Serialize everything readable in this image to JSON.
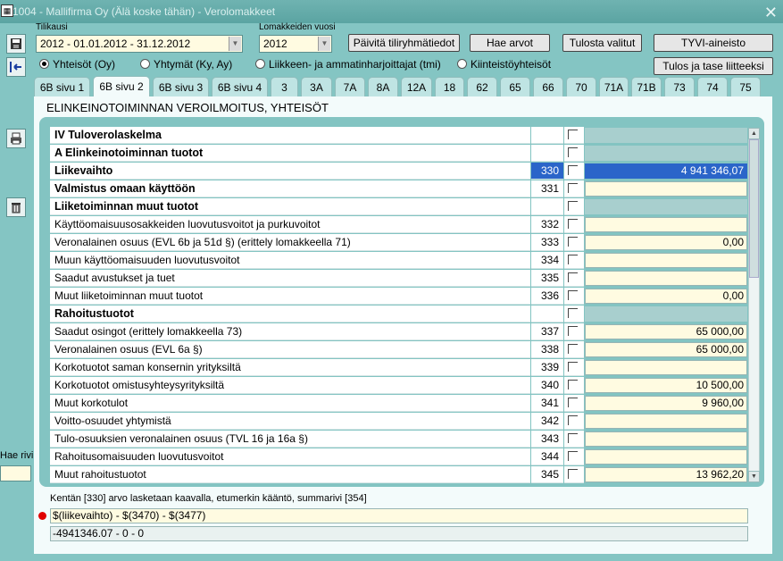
{
  "window": {
    "title": "1004 - Mallifirma Oy (Älä koske tähän) - Verolomakkeet",
    "close": "✕"
  },
  "form": {
    "tilikausi_label": "Tilikausi",
    "tilikausi_value": "2012 - 01.01.2012 - 31.12.2012",
    "vuosi_label": "Lomakkeiden vuosi",
    "vuosi_value": "2012",
    "buttons": {
      "paivita": "Päivitä tiliryhmätiedot",
      "hae": "Hae arvot",
      "tulosta": "Tulosta valitut",
      "tyvi": "TYVI-aineisto",
      "tulos_tase": "Tulos ja tase liitteeksi"
    },
    "radios": [
      {
        "label": "Yhteisöt (Oy)",
        "selected": true
      },
      {
        "label": "Yhtymät (Ky, Ay)",
        "selected": false
      },
      {
        "label": "Liikkeen- ja ammatinharjoittajat (tmi)",
        "selected": false
      },
      {
        "label": "Kiinteistöyhteisöt",
        "selected": false
      }
    ]
  },
  "tabs": [
    "6B sivu 1",
    "6B sivu 2",
    "6B sivu 3",
    "6B sivu 4",
    "3",
    "3A",
    "7A",
    "8A",
    "12A",
    "18",
    "62",
    "65",
    "66",
    "70",
    "71A",
    "71B",
    "73",
    "74",
    "75"
  ],
  "active_tab": "6B sivu 2",
  "section_title": "ELINKEINOTOIMINNAN VEROILMOITUS, YHTEISÖT",
  "rows": [
    {
      "label": "IV  Tuloverolaskelma",
      "code": "",
      "value": "",
      "bold": true,
      "header": true
    },
    {
      "label": "A  Elinkeinotoiminnan tuotot",
      "code": "",
      "value": "",
      "bold": true,
      "header": true
    },
    {
      "label": "Liikevaihto",
      "code": "330",
      "value": "4 941 346,07",
      "bold": true,
      "selected": true
    },
    {
      "label": "Valmistus omaan käyttöön",
      "code": "331",
      "value": "",
      "bold": true
    },
    {
      "label": "Liiketoiminnan muut tuotot",
      "code": "",
      "value": "",
      "bold": true,
      "header": true
    },
    {
      "label": "Käyttöomaisuusosakkeiden luovutusvoitot ja purkuvoitot",
      "code": "332",
      "value": ""
    },
    {
      "label": "Veronalainen osuus (EVL 6b ja 51d §) (erittely lomakkeella 71)",
      "code": "333",
      "value": "0,00"
    },
    {
      "label": "Muun käyttöomaisuuden luovutusvoitot",
      "code": "334",
      "value": ""
    },
    {
      "label": "Saadut avustukset ja tuet",
      "code": "335",
      "value": ""
    },
    {
      "label": "Muut liiketoiminnan muut tuotot",
      "code": "336",
      "value": "0,00"
    },
    {
      "label": "Rahoitustuotot",
      "code": "",
      "value": "",
      "bold": true,
      "header": true
    },
    {
      "label": "Saadut osingot (erittely lomakkeella 73)",
      "code": "337",
      "value": "65 000,00"
    },
    {
      "label": "Veronalainen osuus (EVL 6a §)",
      "code": "338",
      "value": "65 000,00"
    },
    {
      "label": "Korkotuotot saman konsernin yrityksiltä",
      "code": "339",
      "value": ""
    },
    {
      "label": "Korkotuotot omistusyhteysyrityksiltä",
      "code": "340",
      "value": "10 500,00"
    },
    {
      "label": "Muut korkotulot",
      "code": "341",
      "value": "9 960,00"
    },
    {
      "label": "Voitto-osuudet yhtymistä",
      "code": "342",
      "value": ""
    },
    {
      "label": "Tulo-osuuksien veronalainen osuus (TVL 16 ja 16a §)",
      "code": "343",
      "value": ""
    },
    {
      "label": "Rahoitusomaisuuden luovutusvoitot",
      "code": "344",
      "value": ""
    },
    {
      "label": "Muut rahoitustuotot",
      "code": "345",
      "value": "13 962,20"
    }
  ],
  "info_text": "Kentän [330] arvo lasketaan kaavalla, etumerkin kääntö, summarivi [354]",
  "formula": "$(liikevaihto) - $(3470) - $(3477)",
  "result": "-4941346.07 - 0 - 0",
  "hae_rivi_label": "Hae rivi",
  "colors": {
    "background": "#84c5c3",
    "selected": "#2b65c9",
    "input": "#fffbe1"
  }
}
